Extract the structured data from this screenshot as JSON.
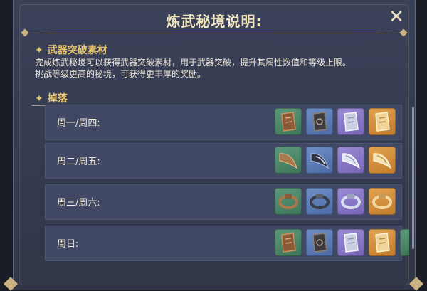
{
  "header": {
    "title": "炼武秘境说明:",
    "close_icon": "close-icon"
  },
  "section_upgrade": {
    "title": "武器突破素材",
    "desc_line1": "完成炼武秘境可以获得武器突破素材，用于武器突破，提升其属性数值和等级上限。",
    "desc_line2": "挑战等级更高的秘境，可获得更丰厚的奖励。"
  },
  "section_drops": {
    "title": "掉落",
    "rows": [
      {
        "day": "周一/周四:",
        "items": [
          "bronze-tile-item-icon",
          "dark-tile-item-icon",
          "silver-tile-item-icon",
          "golden-tile-item-icon"
        ]
      },
      {
        "day": "周二/周五:",
        "items": [
          "bronze-tooth-item-icon",
          "dark-tooth-item-icon",
          "silver-tooth-item-icon",
          "golden-tooth-item-icon"
        ]
      },
      {
        "day": "周三/周六:",
        "items": [
          "bronze-chain-item-icon",
          "dark-chain-item-icon",
          "silver-chain-item-icon",
          "golden-chain-item-icon"
        ]
      },
      {
        "day": "周日:",
        "items": [
          "bronze-tile-item-icon",
          "dark-tile-item-icon",
          "silver-tile-item-icon",
          "golden-tile-item-icon"
        ]
      }
    ]
  },
  "colors": {
    "gold_text": "#e8c36c",
    "quality_green": "#4e8a6a",
    "quality_blue": "#5b7bb8",
    "quality_purple": "#8a76c6",
    "quality_orange": "#d48f3c"
  }
}
